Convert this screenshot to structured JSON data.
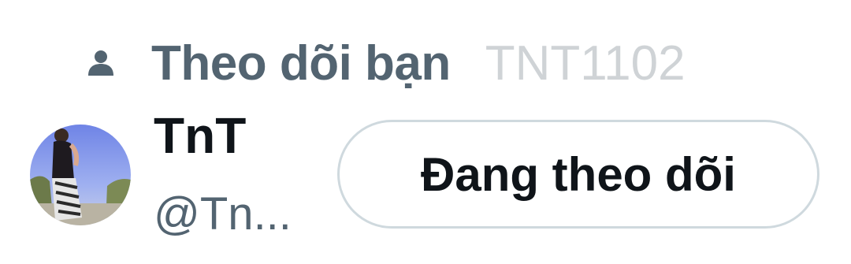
{
  "follows_you": {
    "icon": "person-icon",
    "label": "Theo dõi bạn",
    "username": "TNT1102"
  },
  "profile": {
    "avatar": "avatar",
    "display_name": "TnT",
    "handle": "@Tn..."
  },
  "follow_button": {
    "label": "Đang theo dõi"
  },
  "colors": {
    "secondary_text": "#536471",
    "primary_text": "#0f1419",
    "faded_text": "#cfd3d6",
    "button_border": "#cfd9de"
  }
}
